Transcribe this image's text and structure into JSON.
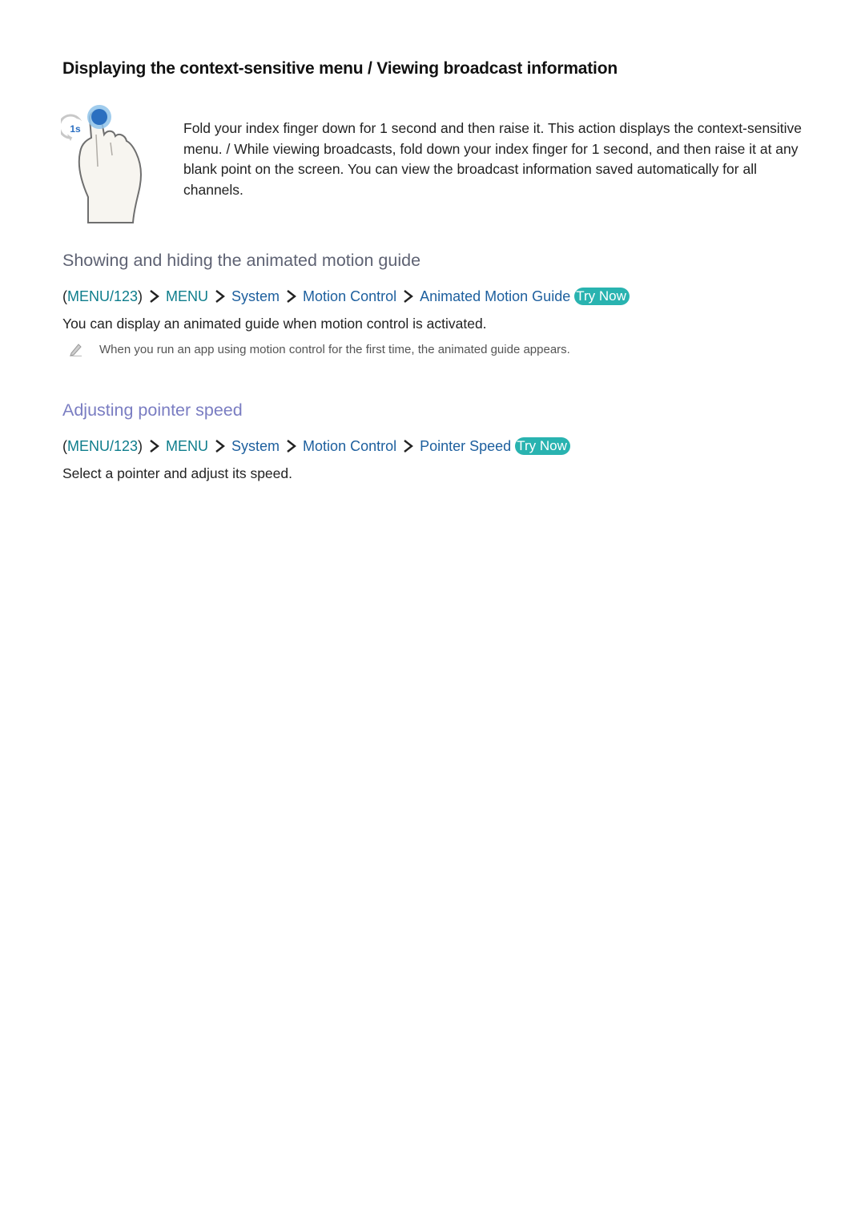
{
  "section1": {
    "heading": "Displaying the context-sensitive menu / Viewing broadcast information",
    "illustration": {
      "icon": "hand-gesture-fold-finger-icon",
      "badge": "1s"
    },
    "paragraph": "Fold your index finger down for 1 second and then raise it. This action displays the context-sensitive menu. / While viewing broadcasts, fold down your index finger for 1 second, and then raise it at any blank point on the screen. You can view the broadcast information saved automatically for all channels."
  },
  "section2": {
    "heading": "Showing and hiding the animated motion guide",
    "path": {
      "open_paren": "(",
      "menu123": "MENU/123",
      "close_paren": ")",
      "items": [
        "MENU",
        "System",
        "Motion Control",
        "Animated Motion Guide"
      ],
      "try_now": "Try Now"
    },
    "description": "You can display an animated guide when motion control is activated.",
    "note": {
      "icon": "pencil-icon",
      "text": "When you run an app using motion control for the first time, the animated guide appears."
    }
  },
  "section3": {
    "heading": "Adjusting pointer speed",
    "path": {
      "open_paren": "(",
      "menu123": "MENU/123",
      "close_paren": ")",
      "items": [
        "MENU",
        "System",
        "Motion Control",
        "Pointer Speed"
      ],
      "try_now": "Try Now"
    },
    "description": "Select a pointer and adjust its speed."
  },
  "colors": {
    "path_blue": "#1d5f9e",
    "menu_teal": "#0e7d8c",
    "try_now_bg": "#29b3b0",
    "subheading_gray": "#5e6273",
    "subheading_purple": "#7a7dc2"
  }
}
